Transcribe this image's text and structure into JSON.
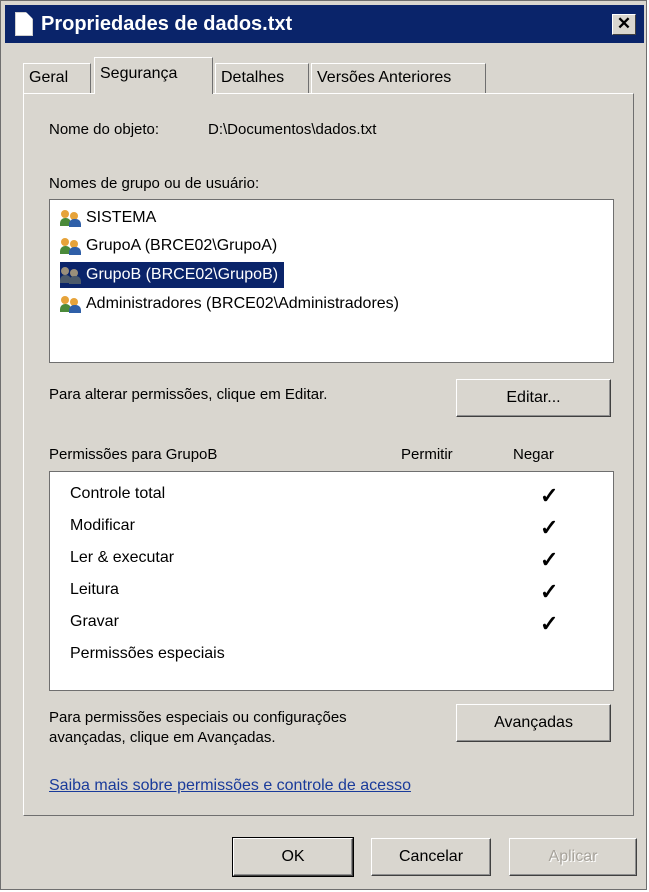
{
  "window": {
    "title": "Propriedades de dados.txt",
    "close_glyph": "✕"
  },
  "tabs": [
    {
      "label": "Geral",
      "active": false
    },
    {
      "label": "Segurança",
      "active": true
    },
    {
      "label": "Detalhes",
      "active": false
    },
    {
      "label": "Versões Anteriores",
      "active": false
    }
  ],
  "object": {
    "label": "Nome do objeto:",
    "value": "D:\\Documentos\\dados.txt"
  },
  "groups": {
    "label": "Nomes de grupo ou de usuário:",
    "items": [
      {
        "name": "SISTEMA",
        "icon": "users-icon",
        "selected": false
      },
      {
        "name": "GrupoA (BRCE02\\GrupoA)",
        "icon": "users-icon",
        "selected": false
      },
      {
        "name": "GrupoB (BRCE02\\GrupoB)",
        "icon": "users-icon",
        "selected": true
      },
      {
        "name": "Administradores (BRCE02\\Administradores)",
        "icon": "users-icon",
        "selected": false
      }
    ]
  },
  "edit": {
    "hint": "Para alterar permissões, clique em Editar.",
    "button": "Editar..."
  },
  "permissions": {
    "header": "Permissões para GrupoB",
    "col_allow": "Permitir",
    "col_deny": "Negar",
    "check_glyph": "✓",
    "rows": [
      {
        "name": "Controle total",
        "allow": false,
        "deny": true
      },
      {
        "name": "Modificar",
        "allow": false,
        "deny": true
      },
      {
        "name": "Ler & executar",
        "allow": false,
        "deny": true
      },
      {
        "name": "Leitura",
        "allow": false,
        "deny": true
      },
      {
        "name": "Gravar",
        "allow": false,
        "deny": true
      },
      {
        "name": "Permissões especiais",
        "allow": false,
        "deny": false
      }
    ]
  },
  "advanced": {
    "hint_line1": "Para permissões especiais ou configurações",
    "hint_line2": "avançadas, clique em Avançadas.",
    "button": "Avançadas"
  },
  "help_link": "Saiba mais sobre permissões e controle de acesso",
  "footer": {
    "ok": "OK",
    "cancel": "Cancelar",
    "apply": "Aplicar"
  },
  "colors": {
    "selection": "#0a246a",
    "face": "#d9d6cf",
    "link": "#1a3b9a"
  }
}
